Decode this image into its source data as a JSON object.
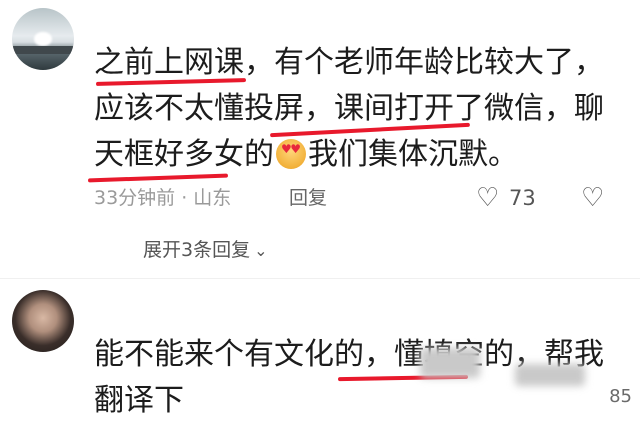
{
  "comment1": {
    "avatar_icon": "avatar-landscape",
    "text": "之前上网课，有个老师年龄比较大了，应该不太懂投屏，课间打开了微信，聊天框好多女的",
    "text_tail": "我们集体沉默。",
    "emoji_icon": "heart-eyes-emoji",
    "time_location": "33分钟前 · 山东",
    "reply_label": "回复",
    "like_icon": "heart-outline-icon",
    "like_count": "73",
    "dislike_icon": "broken-heart-icon",
    "expand_label": "展开3条回复",
    "expand_icon": "chevron-down-icon"
  },
  "comment2": {
    "avatar_icon": "avatar-person",
    "text": "能不能来个有文化的，懂填空的，帮我翻译下"
  },
  "watermark": "85",
  "colors": {
    "underline": "#e8192c",
    "meta_gray": "#9a9a9a",
    "text": "#1c1c1c"
  }
}
